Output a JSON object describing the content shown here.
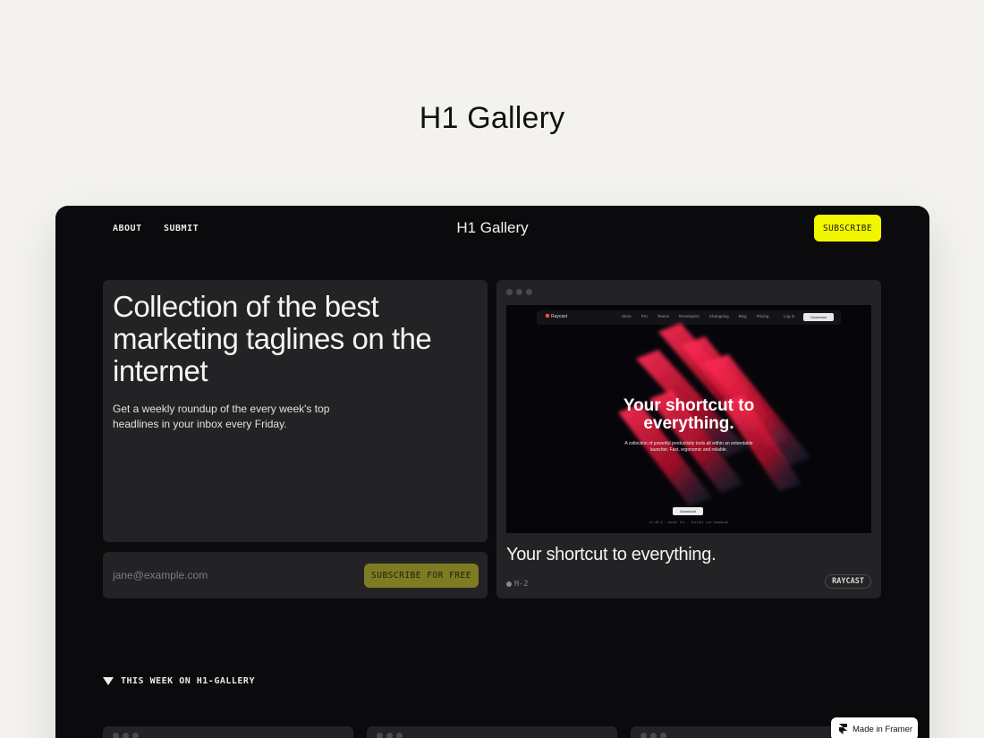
{
  "page": {
    "title": "H1 Gallery"
  },
  "nav": {
    "about": "ABOUT",
    "submit": "SUBMIT",
    "logo": "H1 Gallery",
    "subscribe": "SUBSCRIBE"
  },
  "hero": {
    "title": "Collection of the best marketing taglines on the internet",
    "subtitle": "Get a weekly roundup of the every week's top headlines in your inbox every Friday."
  },
  "signup": {
    "email_placeholder": "jane@example.com",
    "email_value": "",
    "button": "SUBSCRIBE FOR FREE"
  },
  "feature": {
    "screenshot": {
      "logo": "Raycast",
      "nav_links": [
        "Store",
        "Pro",
        "Teams",
        "Developers",
        "Changelog",
        "Blog",
        "Pricing"
      ],
      "login": "Log in",
      "download": "Download",
      "headline_line1": "Your shortcut to",
      "headline_line2": "everything.",
      "description": "A collection of powerful productivity tools all within an extendable launcher. Fast, ergonomic and reliable.",
      "cta": "Download",
      "install_hint": "v1.48.9 · macOS 12+ · Install via homebrew"
    },
    "title": "Your shortcut to everything.",
    "tag": "H-2",
    "brand": "RAYCAST"
  },
  "section": {
    "title": "THIS WEEK ON H1-GALLERY"
  },
  "badge": {
    "label": "Made in Framer"
  },
  "colors": {
    "accent_yellow": "#f2f600",
    "olive_button": "#7e7c22",
    "frame_bg": "#0b0b0d",
    "card_bg": "#232326",
    "page_bg": "#f3f2ef"
  },
  "icons": {
    "section_toggle": "triangle-down-icon",
    "framer": "framer-logo-icon",
    "window_dots": "window-dots-icon"
  }
}
